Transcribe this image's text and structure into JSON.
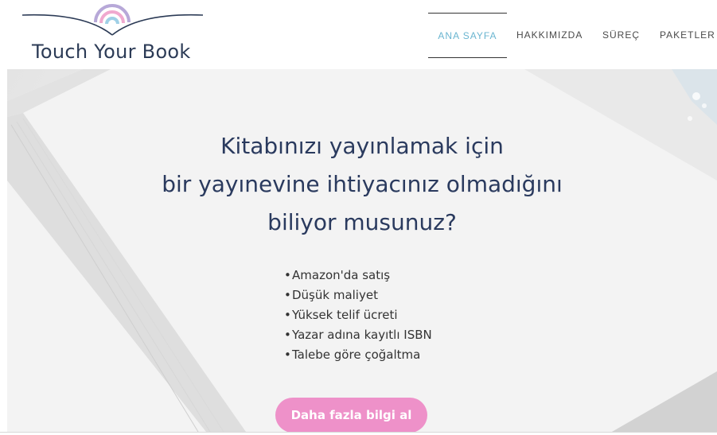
{
  "logo": {
    "text": "Touch Your Book",
    "icon": "open-book-rainbow-icon"
  },
  "nav": {
    "items": [
      {
        "label": "ANA SAYFA",
        "active": true
      },
      {
        "label": "HAKKIMIZDA",
        "active": false
      },
      {
        "label": "SÜREÇ",
        "active": false
      },
      {
        "label": "PAKETLER",
        "active": false
      }
    ]
  },
  "hero": {
    "headline_lines": [
      "Kitabınızı yayınlamak için",
      "bir yayınevine ihtiyacınız olmadığını",
      "biliyor musunuz?"
    ],
    "bullets": [
      "Amazon'da satış",
      "Düşük maliyet",
      "Yüksek telif ücreti",
      "Yazar adına kayıtlı ISBN",
      "Talebe göre çoğaltma"
    ],
    "bullet_glyph": "•",
    "cta_label": "Daha fazla bilgi al"
  },
  "colors": {
    "accent_nav_active": "#6ab5d0",
    "headline": "#2a3a5e",
    "cta_background": "#ee91c9",
    "logo_text": "#2c3b56"
  }
}
